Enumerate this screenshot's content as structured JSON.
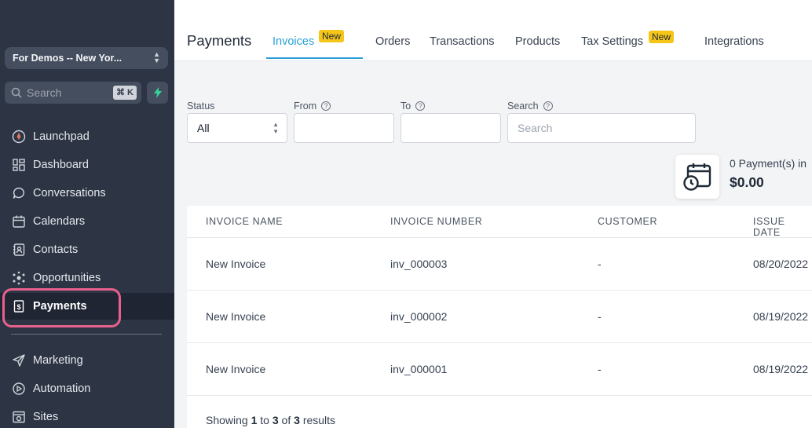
{
  "sidebar": {
    "location": "For Demos -- New Yor...",
    "search_placeholder": "Search",
    "search_shortcut": "⌘ K",
    "items": [
      {
        "label": "Launchpad",
        "icon": "rocket-icon"
      },
      {
        "label": "Dashboard",
        "icon": "grid-icon"
      },
      {
        "label": "Conversations",
        "icon": "chat-icon"
      },
      {
        "label": "Calendars",
        "icon": "calendar-icon"
      },
      {
        "label": "Contacts",
        "icon": "contacts-icon"
      },
      {
        "label": "Opportunities",
        "icon": "opportunities-icon"
      },
      {
        "label": "Payments",
        "icon": "receipt-dollar-icon"
      },
      {
        "label": "Marketing",
        "icon": "send-icon"
      },
      {
        "label": "Automation",
        "icon": "automation-icon"
      },
      {
        "label": "Sites",
        "icon": "sites-icon"
      }
    ],
    "active_item": "Payments",
    "highlight_color": "#e8618c"
  },
  "header": {
    "title": "Payments",
    "tabs": [
      {
        "label": "Invoices",
        "badge": "New"
      },
      {
        "label": "Orders"
      },
      {
        "label": "Transactions"
      },
      {
        "label": "Products"
      },
      {
        "label": "Tax Settings",
        "badge": "New"
      },
      {
        "label": "Integrations"
      }
    ],
    "active_tab": "Invoices",
    "accent_color": "#2a9fd8",
    "badge_color": "#f5c518"
  },
  "filters": {
    "status_label": "Status",
    "status_value": "All",
    "from_label": "From",
    "to_label": "To",
    "search_label": "Search",
    "search_placeholder": "Search"
  },
  "summary": {
    "text": "0  Payment(s) in",
    "amount": "$0.00"
  },
  "table": {
    "columns": [
      "INVOICE NAME",
      "INVOICE NUMBER",
      "CUSTOMER",
      "ISSUE DATE"
    ],
    "rows": [
      [
        "New Invoice",
        "inv_000003",
        "-",
        "08/20/2022"
      ],
      [
        "New Invoice",
        "inv_000002",
        "-",
        "08/19/2022"
      ],
      [
        "New Invoice",
        "inv_000001",
        "-",
        "08/19/2022"
      ]
    ],
    "footer": {
      "prefix": "Showing",
      "from": "1",
      "to_word": "to",
      "to": "3",
      "of_word": "of",
      "total": "3",
      "suffix": "results"
    }
  }
}
